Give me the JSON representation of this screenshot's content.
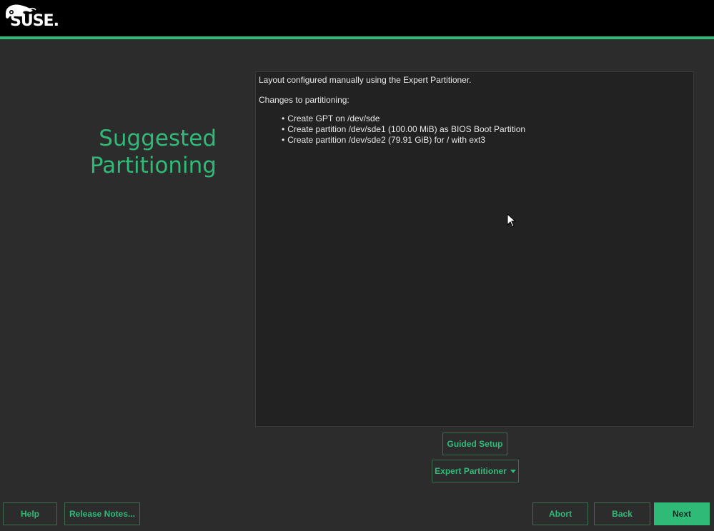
{
  "header": {
    "logo_text": "SUSE."
  },
  "page": {
    "title_line1": "Suggested",
    "title_line2": "Partitioning"
  },
  "summary": {
    "intro": "Layout configured manually using the Expert Partitioner.",
    "changes_heading": "Changes to partitioning:",
    "changes": [
      "Create GPT on /dev/sde",
      "Create partition /dev/sde1 (100.00 MiB) as BIOS Boot Partition",
      "Create partition /dev/sde2 (79.91 GiB) for / with ext3"
    ]
  },
  "actions": {
    "guided_setup": "Guided Setup",
    "expert_partitioner": "Expert Partitioner"
  },
  "footer": {
    "help": "Help",
    "release_notes": "Release Notes...",
    "abort": "Abort",
    "back": "Back",
    "next": "Next"
  },
  "colors": {
    "accent": "#30ba78",
    "background": "#2c2c2c",
    "panel": "#222222",
    "header": "#000000"
  },
  "icons": {
    "logo": "suse-chameleon-logo",
    "mouse": "mouse-pointer-icon",
    "dropdown": "caret-down-icon"
  }
}
